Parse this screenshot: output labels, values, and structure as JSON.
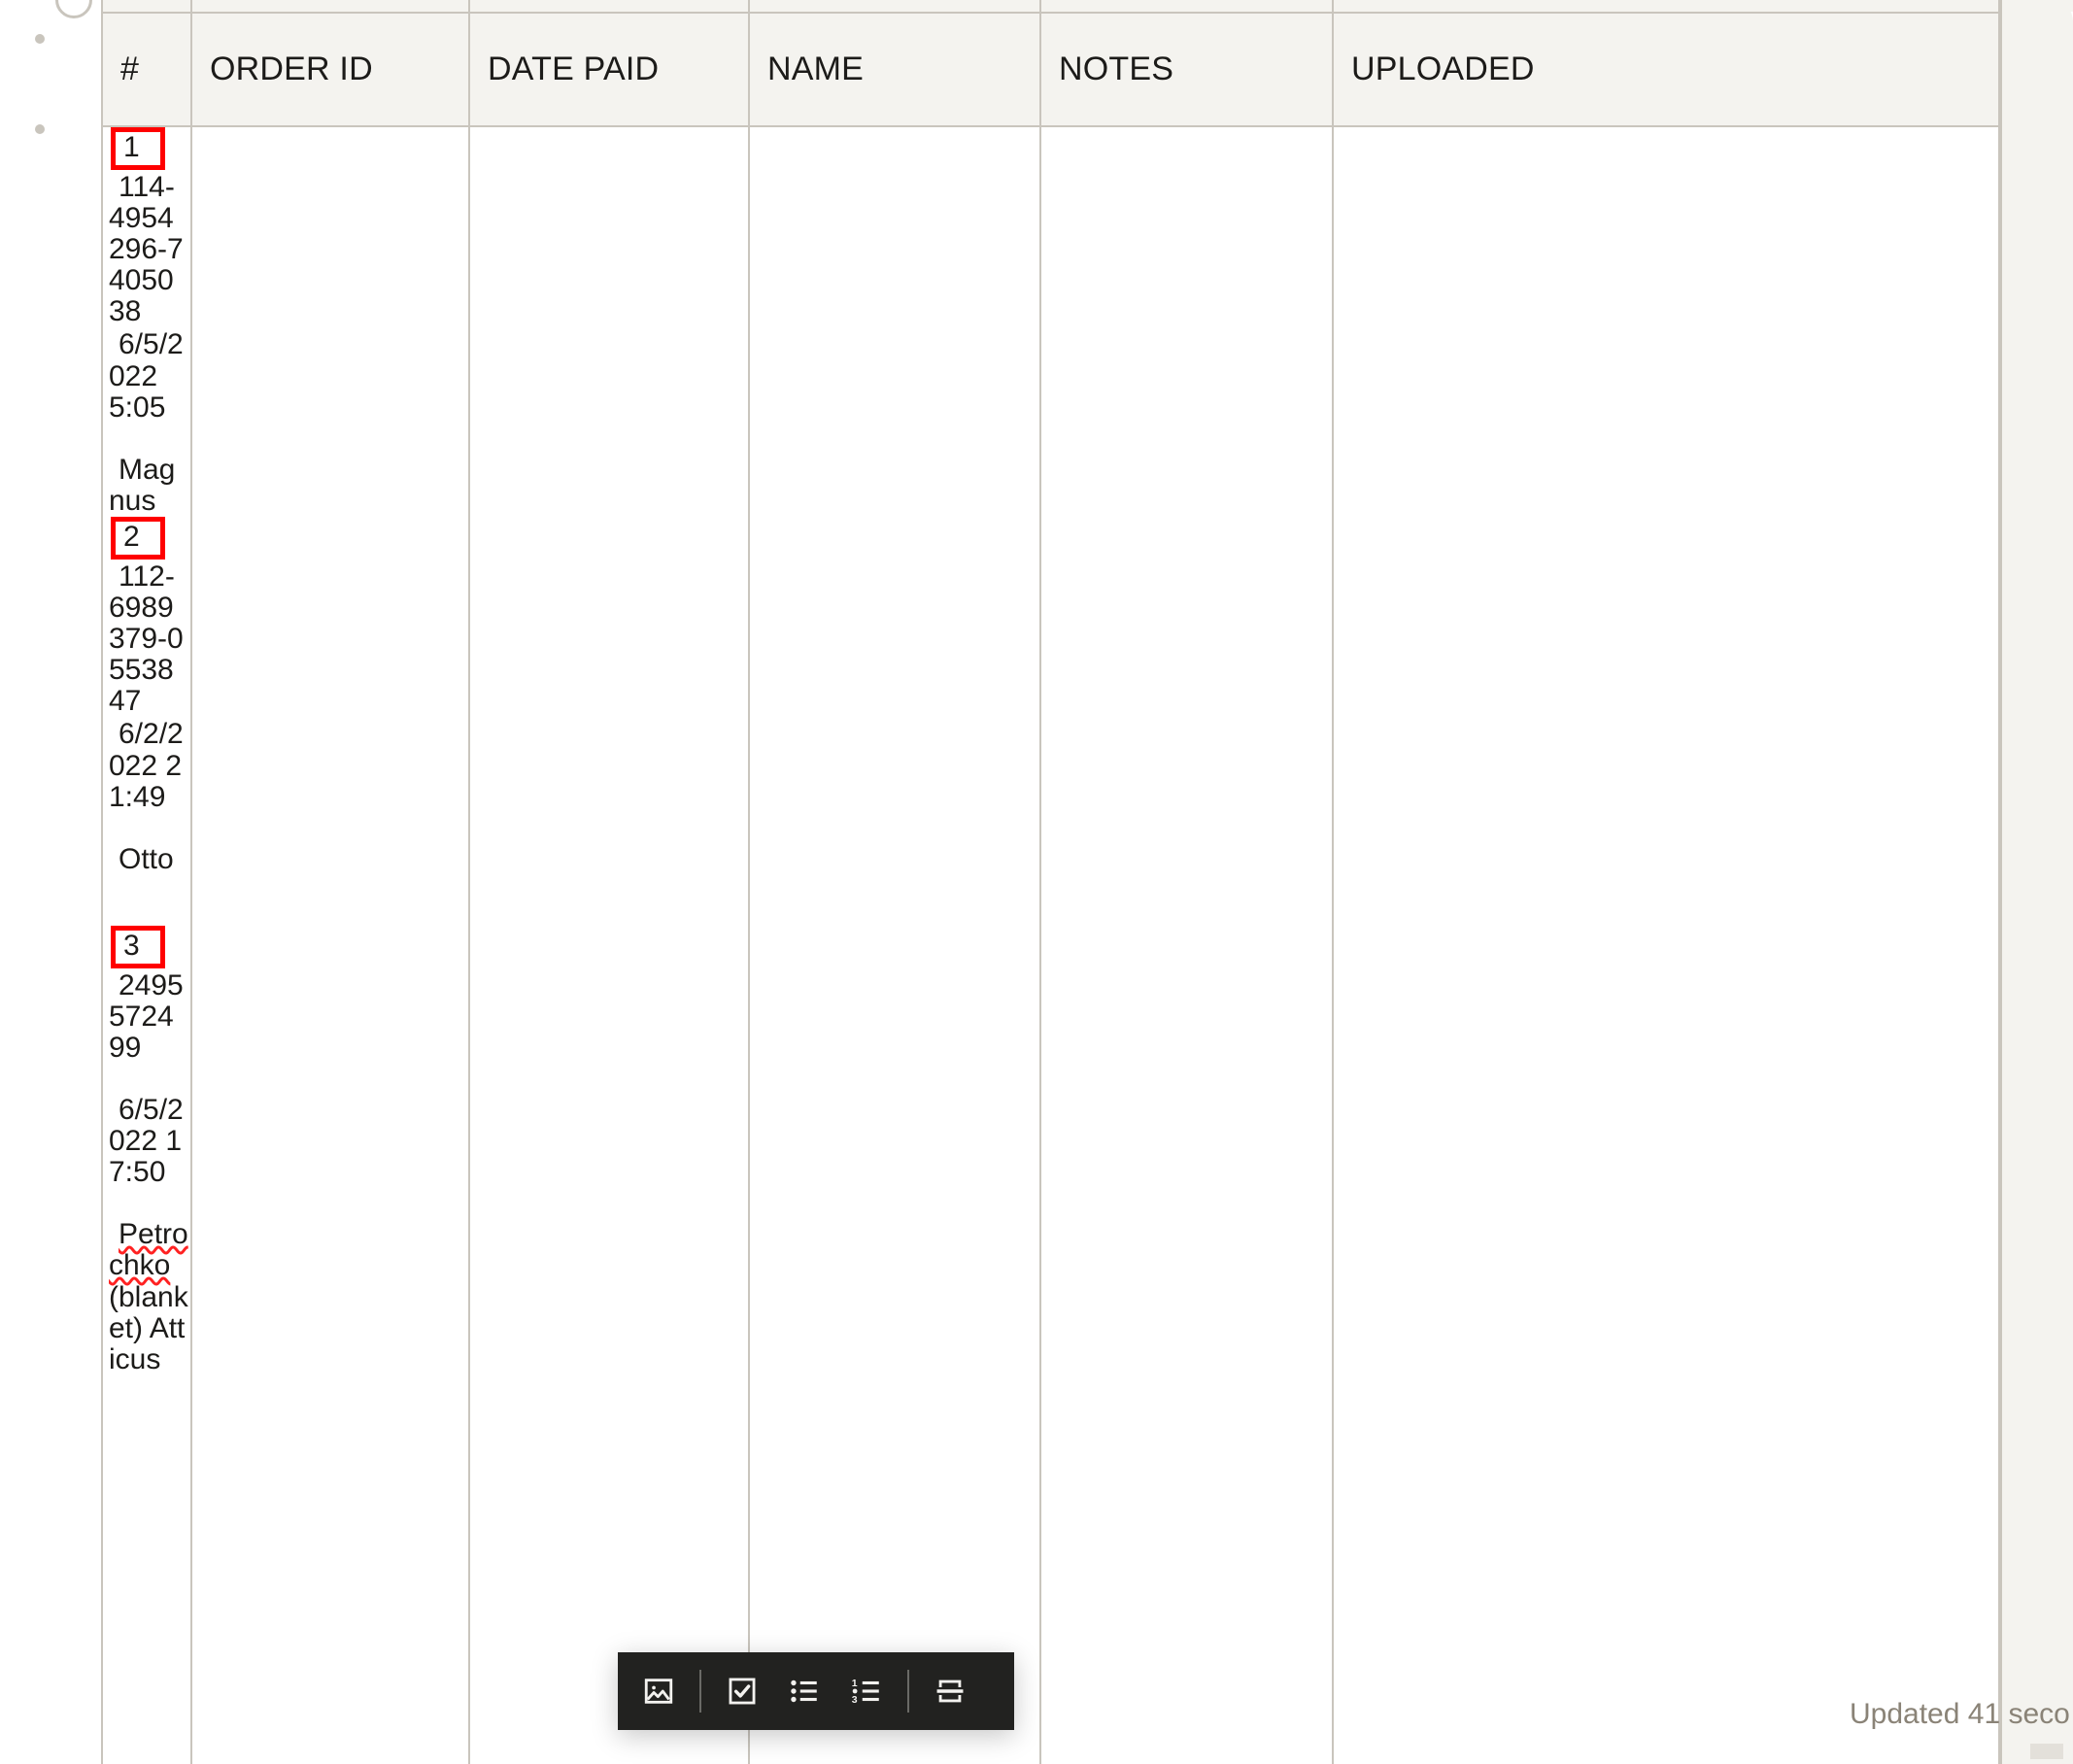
{
  "table": {
    "columns": [
      {
        "key": "num",
        "label": "#"
      },
      {
        "key": "order_id",
        "label": "ORDER ID"
      },
      {
        "key": "date_paid",
        "label": "DATE PAID"
      },
      {
        "key": "name",
        "label": "NAME"
      },
      {
        "key": "notes",
        "label": "NOTES"
      },
      {
        "key": "uploaded",
        "label": "UPLOADED"
      }
    ],
    "rows": [
      {
        "num": "1",
        "order_id": "114-4954296-7405038",
        "date_paid": "6/5/2022 5:05",
        "name": "Magnus",
        "notes": "",
        "uploaded": ""
      },
      {
        "num": "2",
        "order_id": "112-6989379-0553847",
        "date_paid": "6/2/2022 21:49",
        "name": "Otto",
        "notes": "",
        "uploaded": ""
      },
      {
        "num": "3",
        "order_id": "2495572499",
        "date_paid": "6/5/2022 17:50",
        "name": "Petrochko (blanket) Atticus",
        "notes": "",
        "uploaded": ""
      }
    ]
  },
  "cells": {
    "r1_num": "1",
    "r1_order": "114-4954296-7405038",
    "r1_date": "6/5/2022 5:05",
    "r1_name": "Magnus",
    "r2_num": "2",
    "r2_order": "112-6989379-0553847",
    "r2_date": "6/2/2022 21:49",
    "r2_name": "Otto",
    "r3_num": "3",
    "r3_order": "2495572499",
    "r3_date": "6/5/2022 17:50",
    "r3_name_misspelled": "Petrochko",
    "r3_name_rest": " (blanket) Atticus"
  },
  "toolbar": {
    "items": [
      {
        "icon": "image-icon",
        "label": "Insert image"
      },
      {
        "icon": "checklist-icon",
        "label": "Checklist"
      },
      {
        "icon": "bulleted-list-icon",
        "label": "Bulleted list"
      },
      {
        "icon": "numbered-list-icon",
        "label": "Numbered list"
      },
      {
        "icon": "page-break-icon",
        "label": "Page break"
      }
    ],
    "numbered_list_glyphs": [
      "1",
      "•",
      "3"
    ]
  },
  "status": {
    "updated_text": "Updated 41 seco"
  },
  "colors": {
    "header_bg": "#f4f3ef",
    "grid_line": "#c9c5bd",
    "text": "#1c1b19",
    "highlight_box": "#ff0000",
    "toolbar_bg": "#222220",
    "status_text": "#8a8377"
  }
}
